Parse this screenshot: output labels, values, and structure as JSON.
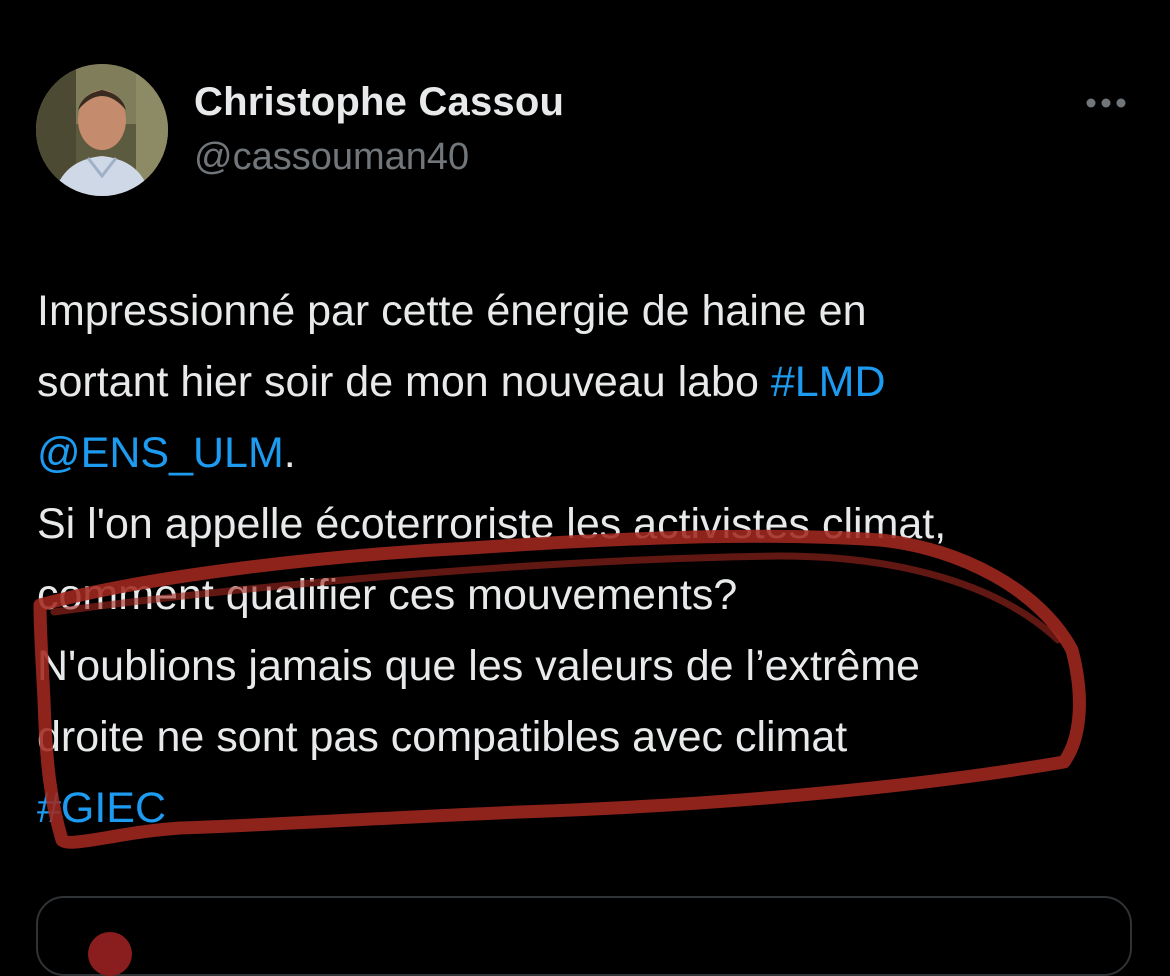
{
  "tweet": {
    "author": {
      "display_name": "Christophe Cassou",
      "handle": "@cassouman40"
    },
    "more_icon": "more-horizontal-icon",
    "text_lines": [
      [
        {
          "text": "Impressionné par cette énergie de haine en",
          "type": "text"
        }
      ],
      [
        {
          "text": "sortant hier soir de mon nouveau labo ",
          "type": "text"
        },
        {
          "text": "#LMD",
          "type": "hashtag"
        }
      ],
      [
        {
          "text": "@ENS_ULM",
          "type": "mention"
        },
        {
          "text": ".",
          "type": "text"
        }
      ],
      [
        {
          "text": "Si l'on appelle écoterroriste les activistes climat,",
          "type": "text"
        }
      ],
      [
        {
          "text": "comment qualifier ces mouvements?",
          "type": "text"
        }
      ],
      [
        {
          "text": "N'oublions jamais que les valeurs de l’extrême",
          "type": "text"
        }
      ],
      [
        {
          "text": "droite ne sont pas compatibles avec climat",
          "type": "text"
        }
      ],
      [
        {
          "text": "#GIEC",
          "type": "hashtag"
        }
      ]
    ]
  },
  "colors": {
    "background": "#000000",
    "text": "#e7e9ea",
    "secondary": "#71767b",
    "link": "#1d9bf0",
    "annotation": "#a2281f"
  }
}
